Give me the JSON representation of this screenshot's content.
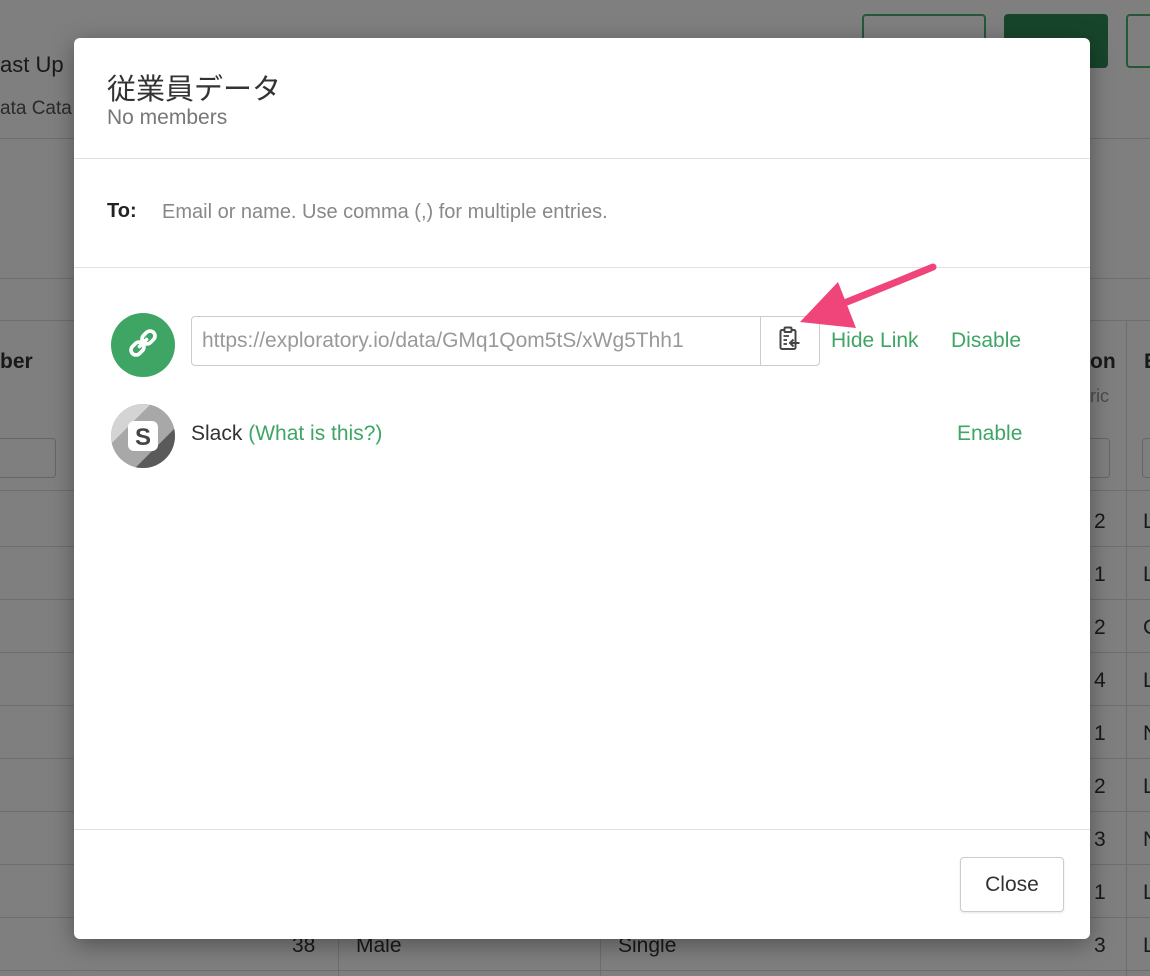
{
  "background": {
    "header_text_1": "ast Up",
    "header_text_2": "ata Cata",
    "col_left_header": "ber",
    "col_right_header": "on",
    "col_right_subheader": "ric",
    "col_far_right_header": "E",
    "col_right_values": [
      "2",
      "1",
      "2",
      "4",
      "1",
      "2",
      "3",
      "1",
      "3"
    ],
    "col_far_right_values": [
      "L",
      "L",
      "C",
      "L",
      "N",
      "L",
      "N",
      "L",
      "L"
    ],
    "bottom_row": {
      "number": "38",
      "gender": "Male",
      "status": "Single"
    }
  },
  "modal": {
    "title": "従業員データ",
    "subtitle": "No members",
    "to_label": "To:",
    "to_placeholder": "Email or name. Use comma (,) for multiple entries.",
    "share_link": {
      "url": "https://exploratory.io/data/GMq1Qom5tS/xWg5Thh1",
      "hide_label": "Hide Link",
      "disable_label": "Disable"
    },
    "slack": {
      "name": "Slack",
      "what_label": "(What is this?)",
      "enable_label": "Enable"
    },
    "close_label": "Close"
  },
  "colors": {
    "accent_green": "#3ea565",
    "annotation_arrow": "#f0457a"
  },
  "icons": [
    "link-icon",
    "clipboard-icon",
    "slack-icon"
  ]
}
